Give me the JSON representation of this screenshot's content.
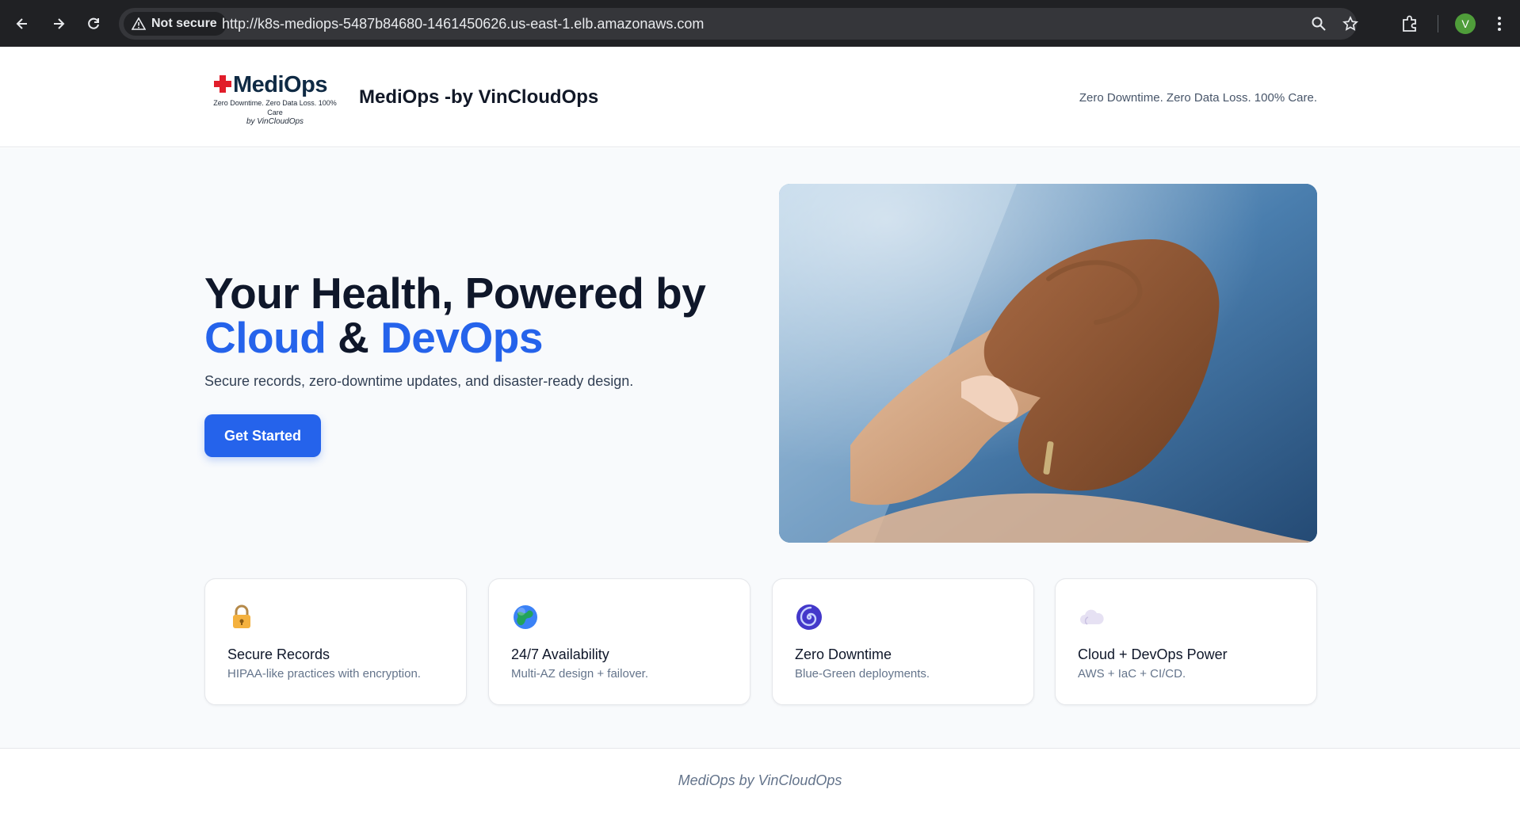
{
  "browser": {
    "security_label": "Not secure",
    "url": "http://k8s-mediops-5487b84680-1461450626.us-east-1.elb.amazonaws.com",
    "profile_initial": "V",
    "profile_color": "#4f9d3a"
  },
  "header": {
    "logo_word": "MediOps",
    "logo_tagline": "Zero Downtime. Zero Data Loss. 100% Care",
    "logo_byline": "by VinCloudOps",
    "brand_title": "MediOps -by VinCloudOps",
    "tagline": "Zero Downtime. Zero Data Loss. 100% Care."
  },
  "hero": {
    "title_line1": "Your Health, Powered by",
    "title_word_cloud": "Cloud",
    "title_amp": " & ",
    "title_word_devops": "DevOps",
    "subtitle": "Secure records, zero-downtime updates, and disaster-ready design.",
    "cta_label": "Get Started",
    "accent_color": "#2563eb"
  },
  "features": [
    {
      "icon": "lock-icon",
      "title": "Secure Records",
      "desc": "HIPAA-like practices with encryption."
    },
    {
      "icon": "globe-icon",
      "title": "24/7 Availability",
      "desc": "Multi-AZ design + failover."
    },
    {
      "icon": "spiral-icon",
      "title": "Zero Downtime",
      "desc": "Blue-Green deployments."
    },
    {
      "icon": "cloud-icon",
      "title": "Cloud + DevOps Power",
      "desc": "AWS + IaC + CI/CD."
    }
  ],
  "footer": {
    "text": "MediOps by VinCloudOps"
  }
}
